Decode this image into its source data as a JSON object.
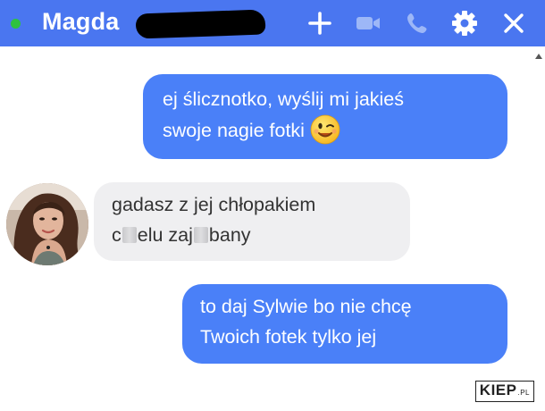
{
  "header": {
    "contact_name": "Magda",
    "status": "online",
    "colors": {
      "background": "#4a76f0",
      "online": "#2ec23f"
    },
    "icons": [
      "plus-icon",
      "video-camera-icon",
      "phone-icon",
      "gear-icon",
      "close-icon"
    ]
  },
  "messages": [
    {
      "direction": "outgoing",
      "lines": [
        "ej ślicznotko, wyślij mi jakieś",
        "swoje nagie fotki"
      ],
      "emoji": "winking-face-emoji"
    },
    {
      "direction": "incoming",
      "line1": "gadasz z jej chłopakiem",
      "line2_parts": [
        "c",
        "elu zaj",
        "bany"
      ]
    },
    {
      "direction": "outgoing",
      "lines": [
        "to daj Sylwie bo nie chcę",
        "Twoich fotek tylko jej"
      ]
    }
  ],
  "colors": {
    "outgoing_bubble": "#4a80f8",
    "incoming_bubble": "#efeff1"
  },
  "watermark": {
    "brand": "KIEP",
    "suffix": ".PL"
  }
}
